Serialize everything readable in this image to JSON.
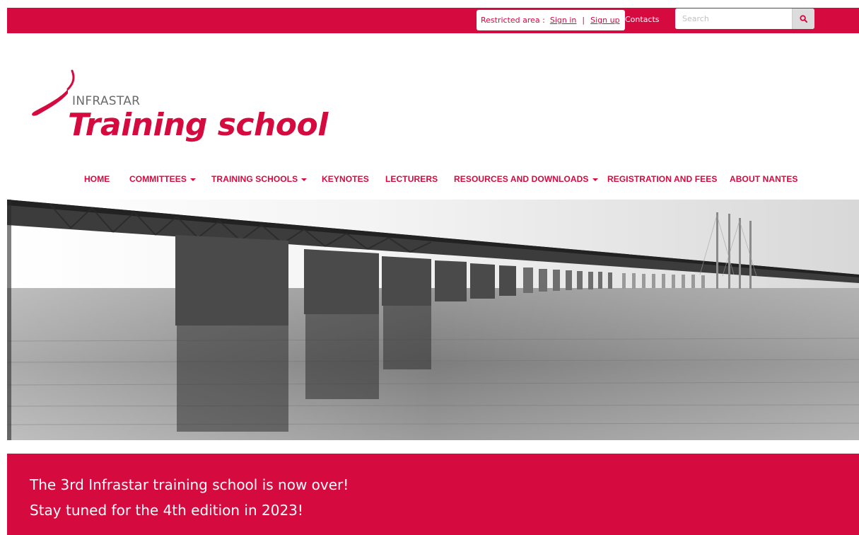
{
  "topbar": {
    "restricted_label": "Restricted area :",
    "sign_in": "Sign in",
    "separator": "|",
    "sign_up": "Sign up",
    "contacts": "Contacts",
    "search_placeholder": "Search",
    "search_icon": "search-icon"
  },
  "logo": {
    "brand": "INFRASTAR",
    "name": "Training school",
    "icon": "swoosh-logo-icon"
  },
  "nav": {
    "items": [
      {
        "label": "HOME",
        "dropdown": false
      },
      {
        "label": "COMMITTEES",
        "dropdown": true
      },
      {
        "label": "TRAINING SCHOOLS",
        "dropdown": true
      },
      {
        "label": "KEYNOTES",
        "dropdown": false
      },
      {
        "label": "LECTURERS",
        "dropdown": false
      },
      {
        "label": "RESOURCES AND DOWNLOADS",
        "dropdown": true
      },
      {
        "label": "REGISTRATION AND FEES",
        "dropdown": false
      },
      {
        "label": "ABOUT NANTES",
        "dropdown": false
      }
    ]
  },
  "banner": {
    "line1": "The 3rd Infrastar training school is now over!",
    "line2": "Stay tuned for the 4th edition in 2023!"
  },
  "colors": {
    "brand_red": "#d50a3e",
    "logo_grey": "#6b6b6b"
  }
}
